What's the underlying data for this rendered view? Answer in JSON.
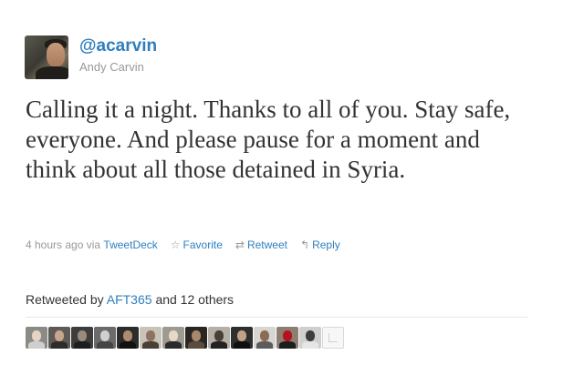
{
  "user": {
    "handle": "@acarvin",
    "full_name": "Andy Carvin",
    "avatar_icon": "user-avatar"
  },
  "tweet": {
    "text": "Calling it a night. Thanks to all of you. Stay safe, everyone. And please pause for a moment and think about all those detained in Syria."
  },
  "meta": {
    "time": "4 hours ago",
    "via_label": "via",
    "source": "TweetDeck",
    "favorite_label": "Favorite",
    "retweet_label": "Retweet",
    "reply_label": "Reply",
    "favorite_icon": "star-icon",
    "retweet_icon": "retweet-icon",
    "reply_icon": "reply-icon"
  },
  "retweets": {
    "prefix": "Retweeted by",
    "user": "AFT365",
    "suffix": "and 12 others"
  },
  "colors": {
    "link": "#2e7fbf",
    "muted": "#999999",
    "text": "#333333"
  }
}
